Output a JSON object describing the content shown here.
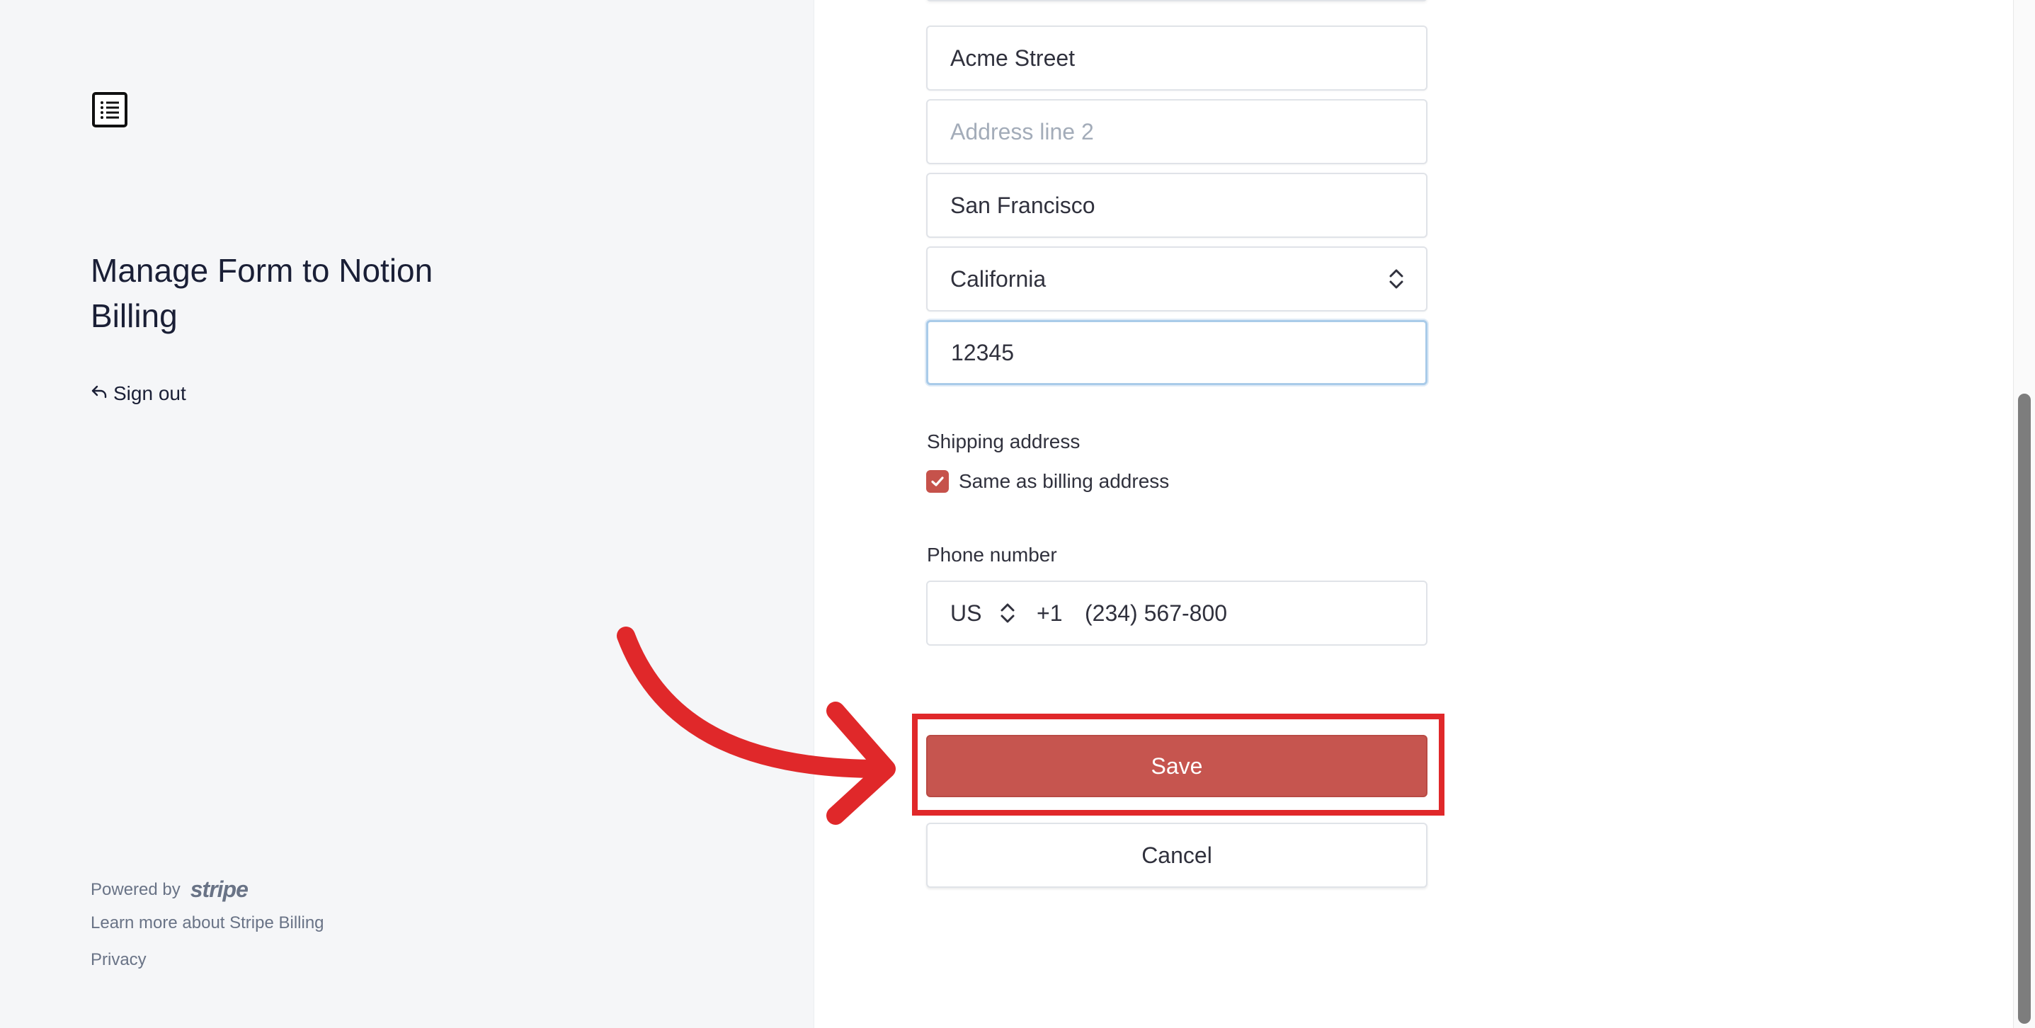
{
  "sidebar": {
    "logo_icon": "list-document-icon",
    "title": "Manage Form to Notion Billing",
    "sign_out_label": "Sign out",
    "sign_out_icon": "reply-arrow-icon",
    "powered_by_label": "Powered by",
    "stripe_logo": "stripe",
    "learn_more_label": "Learn more about Stripe Billing",
    "privacy_label": "Privacy"
  },
  "form": {
    "address_line1": "Acme Street",
    "address_line2_placeholder": "Address line 2",
    "city": "San Francisco",
    "state": "California",
    "postal_code": "12345",
    "shipping_label": "Shipping address",
    "same_as_billing_label": "Same as billing address",
    "same_as_billing_checked": true,
    "phone_label": "Phone number",
    "phone_country": "US",
    "phone_code": "+1",
    "phone_number": "(234) 567-800",
    "save_label": "Save",
    "cancel_label": "Cancel"
  },
  "annotation": {
    "highlight_color": "#e0282a"
  },
  "colors": {
    "accent": "#c6554f",
    "sidebar_bg": "#f5f6f8",
    "text": "#30313d"
  }
}
